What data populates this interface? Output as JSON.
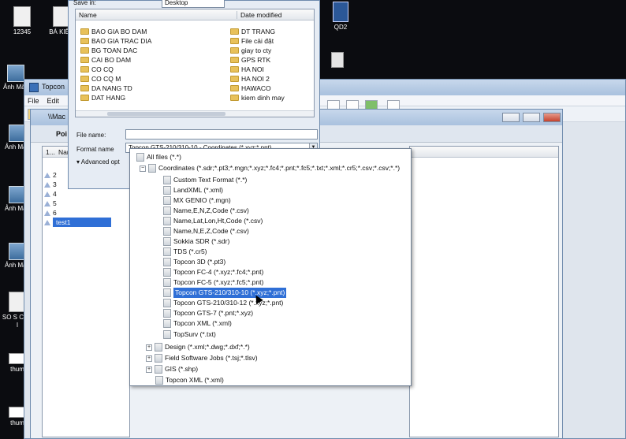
{
  "desktop": {
    "icons": [
      {
        "label": "12345"
      },
      {
        "label": "BÁ KIÊN"
      },
      {
        "label": "Ảnh Màn"
      },
      {
        "label": "Ảnh Màn"
      },
      {
        "label": "Ảnh Màn"
      },
      {
        "label": "Ảnh Màn"
      },
      {
        "label": "SO S CÁC I"
      },
      {
        "label": "thum"
      },
      {
        "label": "thum"
      },
      {
        "label": "QD2"
      }
    ]
  },
  "main_window": {
    "title": "Topcon",
    "menu": [
      "File",
      "Edit"
    ]
  },
  "sub_window": {
    "path": "\\\\Mac",
    "section": "Poi",
    "list_header": "Nam",
    "rows": [
      {
        "num": "2",
        "name": ""
      },
      {
        "num": "3",
        "name": ""
      },
      {
        "num": "4",
        "name": ""
      },
      {
        "num": "5",
        "name": ""
      },
      {
        "num": "6",
        "name": ""
      },
      {
        "num": "",
        "name": "test1"
      }
    ],
    "row_header_num": "1..."
  },
  "save_dialog": {
    "save_in_label": "Save in:",
    "save_in_value": "Desktop",
    "col_name": "Name",
    "col_date": "Date modified",
    "folders_left": [
      "BAO GIA BO DAM",
      "BAO GIA TRAC DIA",
      "BG TOAN DAC",
      "CAI BO DAM",
      "CO CQ",
      "CO CQ M",
      "DA NANG TD",
      "DAT HANG"
    ],
    "folders_right": [
      "DT TRANG",
      "File cải đặt",
      "giay to cty",
      "GPS RTK",
      "HA NOI",
      "HA NOI 2",
      "HAWACO",
      "kiem dinh may"
    ],
    "file_name_label": "File name:",
    "file_name_value": "",
    "format_label": "Format name",
    "format_value": "Topcon GTS-210/310-10 - Coordinates (*.xyz;*.pnt)",
    "advanced_label": "Advanced opt"
  },
  "format_tree": {
    "root": "All files (*.*)",
    "coordinates_group": "Coordinates (*.sdr;*.pt3;*.mgn;*.xyz;*.fc4;*.pnt;*.fc5;*.txt;*.xml;*.cr5;*.csv;*.csv;*.*)",
    "coordinates_items": [
      "Custom Text Format (*.*)",
      "LandXML (*.xml)",
      "MX GENIO (*.mgn)",
      "Name,E,N,Z,Code (*.csv)",
      "Name,Lat,Lon,Ht,Code (*.csv)",
      "Name,N,E,Z,Code (*.csv)",
      "Sokkia SDR (*.sdr)",
      "TDS (*.cr5)",
      "Topcon 3D (*.pt3)",
      "Topcon FC-4 (*.xyz;*.fc4;*.pnt)",
      "Topcon FC-5 (*.xyz;*.fc5;*.pnt)",
      "Topcon GTS-210/310-10 (*.xyz;*.pnt)",
      "Topcon GTS-210/310-12 (*.xyz;*.pnt)",
      "Topcon GTS-7 (*.pnt;*.xyz)",
      "Topcon XML (*.xml)",
      "TopSurv (*.txt)"
    ],
    "selected_index": 11,
    "other_groups": [
      "Design (*.xml;*.dwg;*.dxf;*.*)",
      "Field Software Jobs (*.tsj;*.tlsv)",
      "GIS (*.shp)"
    ],
    "last_item": "Topcon XML (*.xml)"
  }
}
